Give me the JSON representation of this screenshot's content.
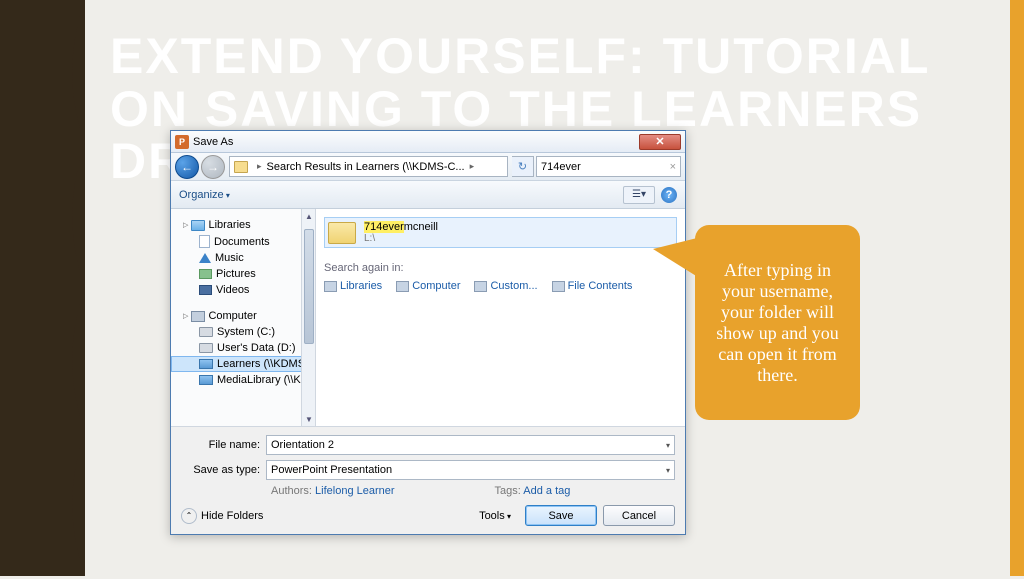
{
  "slide": {
    "title": "EXTEND YOURSELF: TUTORIAL ON SAVING TO THE LEARNERS DRIVE"
  },
  "dialog": {
    "title": "Save As",
    "icon_letter": "P",
    "address": {
      "text": "Search Results in Learners (\\\\KDMS-C...",
      "chev": "▸"
    },
    "search_value": "714ever",
    "toolbar": {
      "organize": "Organize",
      "view_glyph": "☰▾"
    },
    "nav": {
      "libraries": {
        "label": "Libraries",
        "items": [
          "Documents",
          "Music",
          "Pictures",
          "Videos"
        ]
      },
      "computer": {
        "label": "Computer",
        "items": [
          "System (C:)",
          "User's Data (D:)",
          "Learners (\\\\KDMS",
          "MediaLibrary (\\\\K"
        ]
      }
    },
    "result": {
      "highlighted": "714ever",
      "rest": "mcneill",
      "sub": "L:\\"
    },
    "search_again": {
      "label": "Search again in:",
      "options": [
        "Libraries",
        "Computer",
        "Custom...",
        "File Contents"
      ]
    },
    "file_name_label": "File name:",
    "file_name_value": "Orientation 2",
    "save_type_label": "Save as type:",
    "save_type_value": "PowerPoint Presentation",
    "authors_label": "Authors:",
    "authors_value": "Lifelong Learner",
    "tags_label": "Tags:",
    "tags_value": "Add a tag",
    "hide_folders": "Hide Folders",
    "tools": "Tools",
    "save": "Save",
    "cancel": "Cancel"
  },
  "callout": {
    "text": "After typing in your username, your folder will show up and you can open it from there."
  }
}
